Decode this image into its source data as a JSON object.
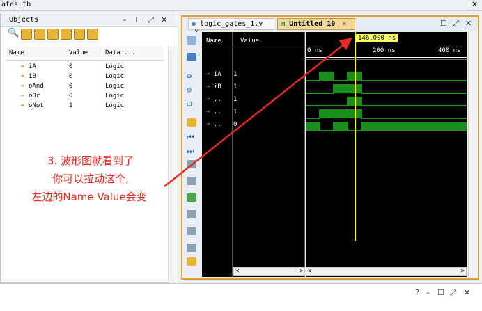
{
  "window": {
    "title": "ates_tb",
    "close_icon": "✕"
  },
  "objects_panel": {
    "title": "Objects",
    "controls": [
      "–",
      "☐",
      "⤢",
      "✕"
    ],
    "columns": [
      "Name",
      "Value",
      "Data ..."
    ],
    "rows": [
      {
        "name": "iA",
        "value": "0",
        "type": "Logic"
      },
      {
        "name": "iB",
        "value": "0",
        "type": "Logic"
      },
      {
        "name": "oAnd",
        "value": "0",
        "type": "Logic"
      },
      {
        "name": "oOr",
        "value": "0",
        "type": "Logic"
      },
      {
        "name": "oNot",
        "value": "1",
        "type": "Logic"
      }
    ]
  },
  "wave_window": {
    "tabs": [
      {
        "label": "logic_gates_1.v",
        "close": "✕"
      },
      {
        "label": "Untitled 10",
        "close": "✕"
      }
    ],
    "controls": [
      "☐",
      "⤢",
      "✕"
    ],
    "name_header": "Name",
    "value_header": "Value",
    "cursor_time": "146.000 ns",
    "time_ticks": [
      "0 ns",
      "200 ns",
      "400 ns"
    ],
    "signals": [
      {
        "name": "iA",
        "value": "1"
      },
      {
        "name": "iB",
        "value": "1"
      },
      {
        "name": "..",
        "value": "1"
      },
      {
        "name": "..",
        "value": "1"
      },
      {
        "name": "..",
        "value": "0"
      }
    ],
    "scroll_left": "<",
    "scroll_right": ">"
  },
  "annotation": {
    "line1": "3. 波形图就看到了",
    "line2": "你可以拉动这个,",
    "line3": "左边的Name Value会变"
  },
  "bottom_panel": {
    "controls": [
      "?",
      "–",
      "☐",
      "⤢",
      "✕"
    ]
  },
  "colors": {
    "wave_green": "#22c022",
    "cursor_yellow": "#ffff00",
    "annotation_red": "#e42a1e",
    "accent_orange": "#e0a02a"
  }
}
